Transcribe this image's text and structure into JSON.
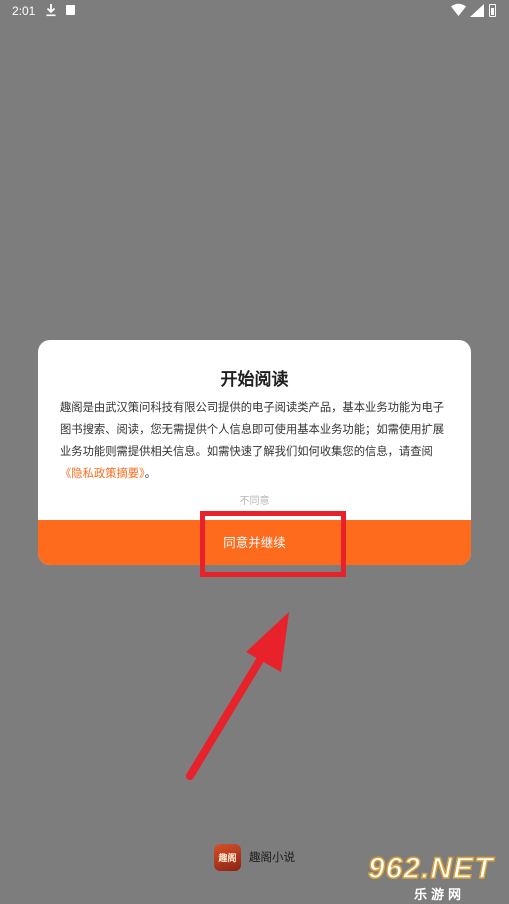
{
  "status_bar": {
    "time": "2:01",
    "icons": [
      "download-icon",
      "app-notification-icon",
      "wifi-icon",
      "cellular-signal-icon",
      "battery-icon"
    ]
  },
  "dialog": {
    "title": "开始阅读",
    "body_text": "趣阁是由武汉策问科技有限公司提供的电子阅读类产品，基本业务功能为电子图书搜索、阅读，您无需提供个人信息即可使用基本业务功能；如需使用扩展业务功能则需提供相关信息。如需快速了解我们如何收集您的信息，请查阅",
    "link_text": "《隐私政策摘要》",
    "body_end": "。",
    "decline_label": "不同意",
    "agree_label": "同意并继续"
  },
  "colors": {
    "accent": "#ff6b1c",
    "annotation": "#e8222b",
    "overlay": "#7d7d7d"
  },
  "brand": {
    "logo_text": "趣阁",
    "name": "趣阁小说"
  },
  "watermark": {
    "top": "962.NET",
    "bottom": "乐游网"
  }
}
